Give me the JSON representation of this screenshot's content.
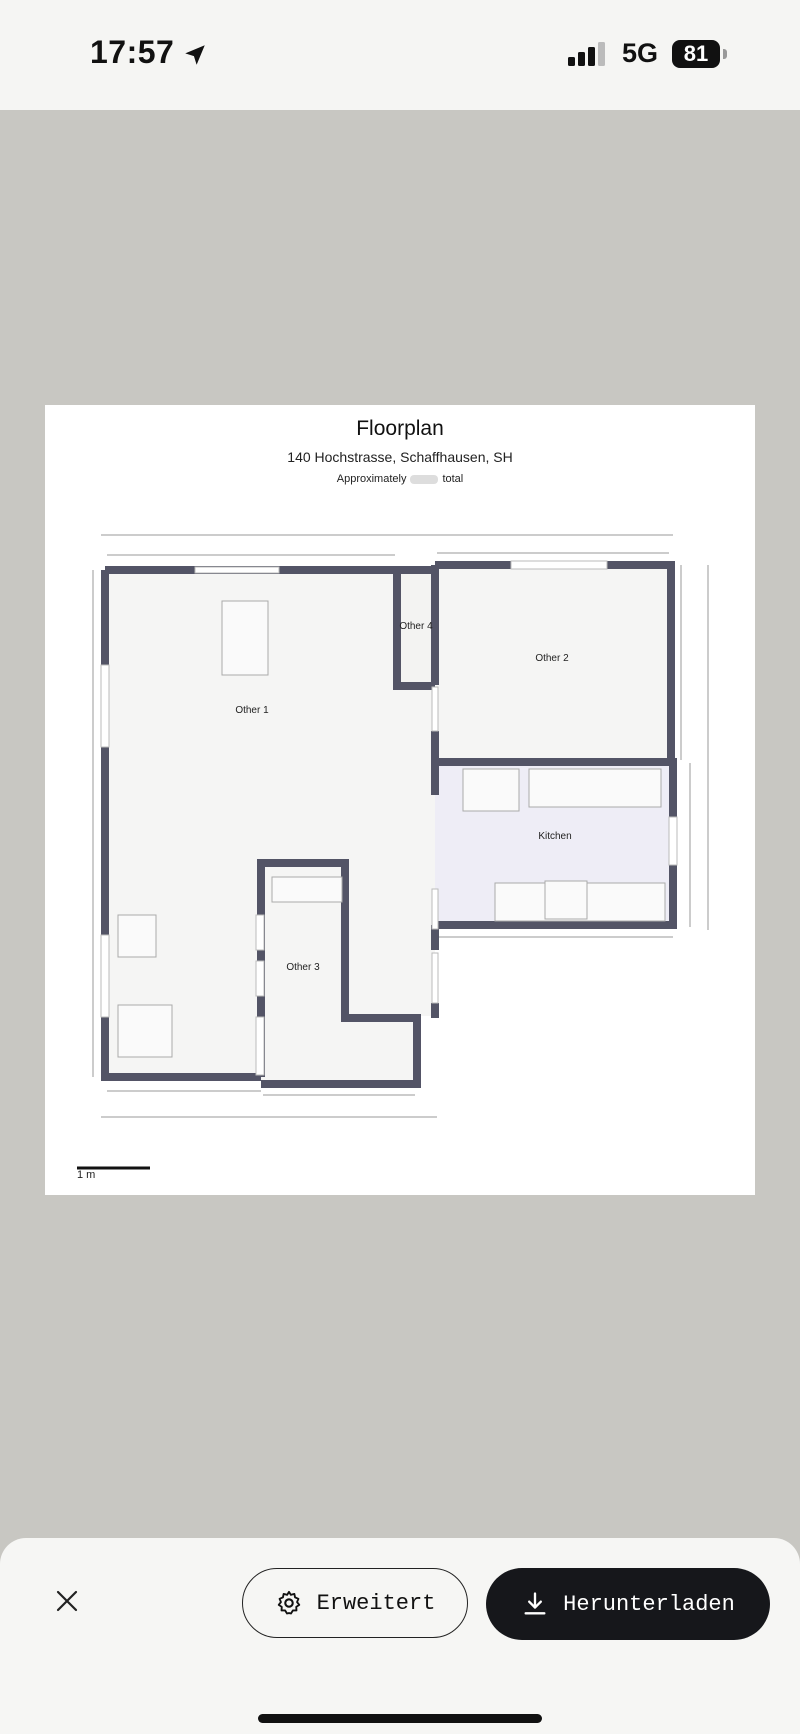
{
  "status_bar": {
    "time": "17:57",
    "network": "5G",
    "battery": "81"
  },
  "floorplan": {
    "title": "Floorplan",
    "address": "140 Hochstrasse, Schaffhausen, SH",
    "approx_prefix": "Approximately",
    "approx_suffix": "total",
    "rooms": {
      "other1": "Other 1",
      "other2": "Other 2",
      "other3": "Other 3",
      "other4": "Other 4",
      "kitchen": "Kitchen"
    },
    "scale_label": "1 m"
  },
  "actions": {
    "advanced_label": "Erweitert",
    "download_label": "Herunterladen"
  },
  "colors": {
    "wall": "#535466",
    "kitchen_fill": "#eeedf6",
    "room_fill": "#f5f5f4",
    "download_bg": "#16171b"
  }
}
